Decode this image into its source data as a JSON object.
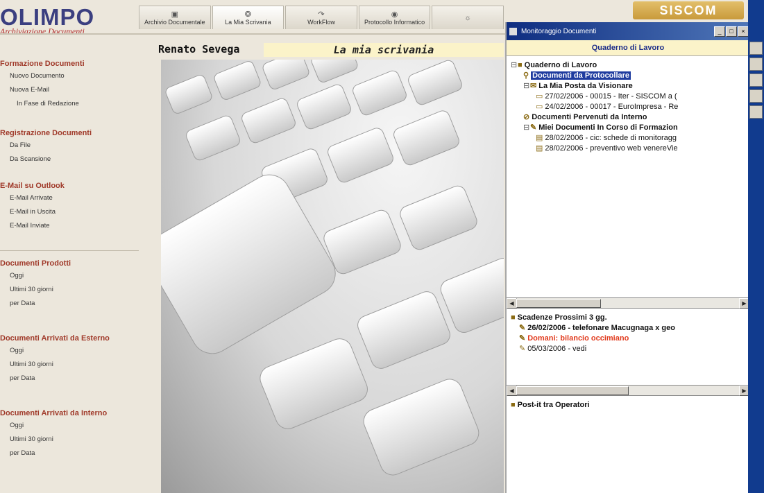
{
  "logo": {
    "title": "OLIMPO",
    "subtitle": "Archiviazione Documenti"
  },
  "nav": {
    "tabs": [
      {
        "label": "Archivio Documentale",
        "icon": "archive-icon"
      },
      {
        "label": "La Mia Scrivania",
        "icon": "desk-icon",
        "active": true
      },
      {
        "label": "WorkFlow",
        "icon": "workflow-icon"
      },
      {
        "label": "Protocollo Informatico",
        "icon": "protocol-icon"
      },
      {
        "label": "",
        "icon": "globe-icon"
      }
    ]
  },
  "brand": "SISCOM",
  "user": {
    "name": "Renato Sevega"
  },
  "desk_title": "La mia scrivania",
  "sidebar": {
    "sections": [
      {
        "title": "Formazione Documenti",
        "items": [
          "Nuovo Documento",
          "Nuova E-Mail",
          "In Fase di Redazione"
        ]
      },
      {
        "title": "Registrazione Documenti",
        "items": [
          "Da File",
          "Da Scansione"
        ]
      },
      {
        "title": "E-Mail su Outlook",
        "items": [
          "E-Mail Arrivate",
          "E-Mail in Uscita",
          "E-Mail Inviate"
        ]
      },
      {
        "title": "Documenti Prodotti",
        "items": [
          "Oggi",
          "Ultimi 30 giorni",
          "per Data"
        ]
      },
      {
        "title": "Documenti Arrivati da Esterno",
        "items": [
          "Oggi",
          "Ultimi 30 giorni",
          "per Data"
        ]
      },
      {
        "title": "Documenti Arrivati da Interno",
        "items": [
          "Oggi",
          "Ultimi 30 giorni",
          "per Data"
        ]
      }
    ]
  },
  "monitor": {
    "window_title": "Monitoraggio Documenti",
    "panel_header": "Quaderno di Lavoro",
    "tree": {
      "root": "Quaderno di Lavoro",
      "selected": "Documenti da Protocollare",
      "posta": "La Mia Posta da Visionare",
      "posta_items": [
        "27/02/2006 - 00015 - Iter - SISCOM a (",
        "24/02/2006 - 00017 - EuroImpresa - Re"
      ],
      "pervenuti": "Documenti Pervenuti da Interno",
      "in_corso": "Miei Documenti In Corso di Formazion",
      "in_corso_items": [
        "28/02/2006 - cic: schede di monitoragg",
        "28/02/2006 - preventivo web venereVie"
      ]
    },
    "deadlines": {
      "title": "Scadenze Prossimi 3 gg.",
      "items": [
        "26/02/2006 - telefonare Macugnaga x geo",
        "Domani: bilancio occimiano",
        "05/03/2006 - vedi"
      ]
    },
    "postit": {
      "title": "Post-it tra Operatori"
    }
  }
}
